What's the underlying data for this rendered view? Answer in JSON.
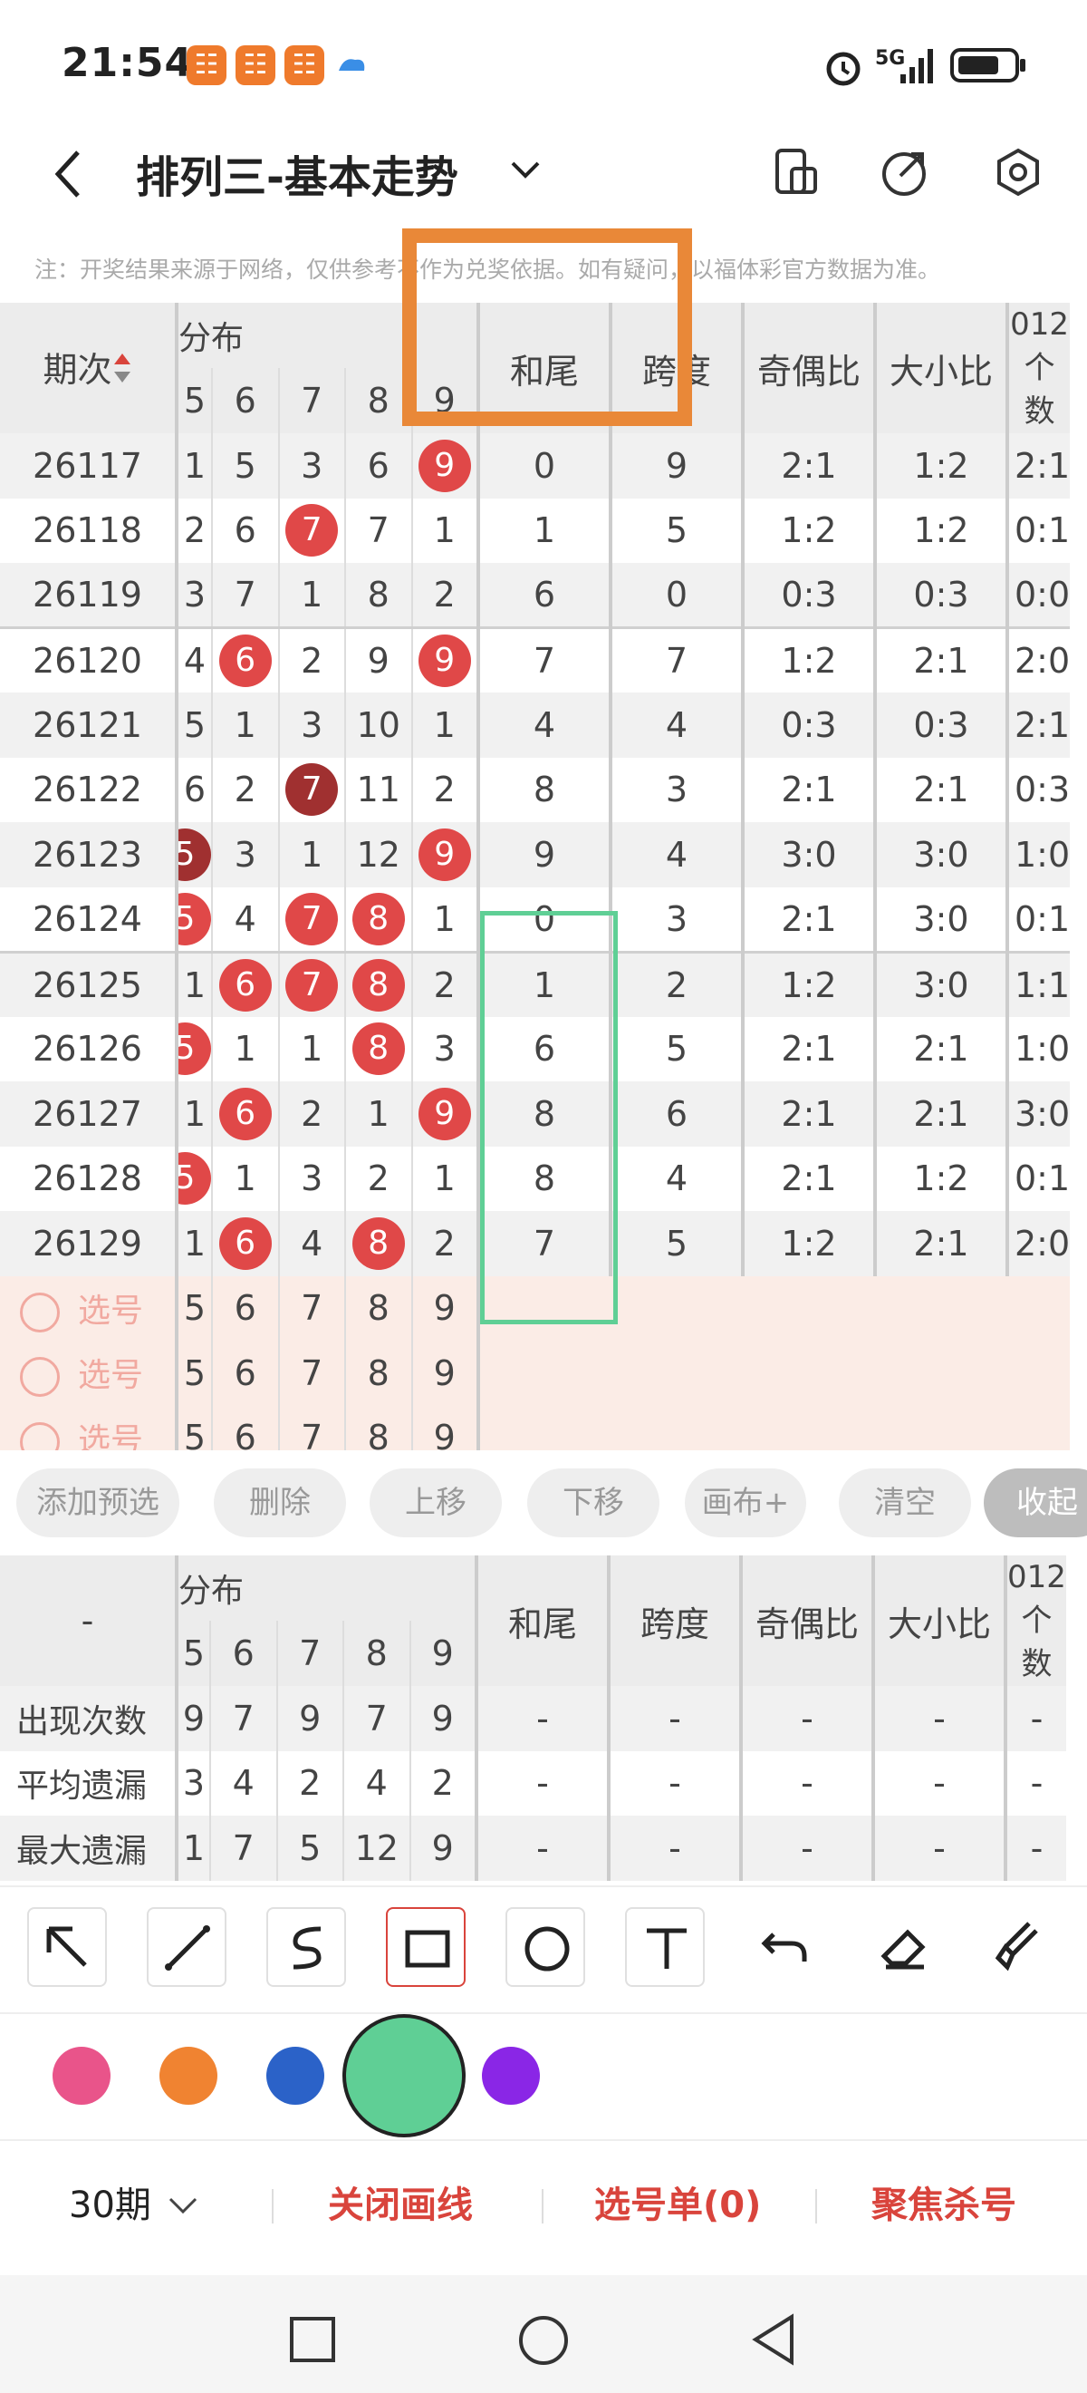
{
  "status": {
    "time": "21:54",
    "network": "5G"
  },
  "app_icons": [
    "app-icon-1",
    "app-icon-2",
    "app-icon-3",
    "cloud-icon"
  ],
  "header": {
    "title": "排列三-基本走势"
  },
  "notice": "注：开奖结果来源于网络，仅供参考不作为兑奖依据。如有疑问，以福体彩官方数据为准。",
  "table": {
    "head_group": "分布",
    "col_qi": "期次",
    "digits": [
      "5",
      "6",
      "7",
      "8",
      "9"
    ],
    "col_he": "和尾",
    "col_kd": "跨度",
    "col_jo": "奇偶比",
    "col_dx": "大小比",
    "col_012": "012个数",
    "rows": [
      {
        "qi": "26117",
        "d": [
          "1",
          "5",
          "3",
          "6",
          "9"
        ],
        "ball": [
          4
        ],
        "he": "0",
        "kd": "9",
        "jo": "2:1",
        "dx": "1:2",
        "l": "2:1"
      },
      {
        "qi": "26118",
        "d": [
          "2",
          "6",
          "7",
          "7",
          "1"
        ],
        "ball": [
          2
        ],
        "he": "1",
        "kd": "5",
        "jo": "1:2",
        "dx": "1:2",
        "l": "0:1"
      },
      {
        "qi": "26119",
        "d": [
          "3",
          "7",
          "1",
          "8",
          "2"
        ],
        "ball": [],
        "he": "6",
        "kd": "0",
        "jo": "0:3",
        "dx": "0:3",
        "l": "0:0"
      },
      {
        "qi": "26120",
        "d": [
          "4",
          "6",
          "2",
          "9",
          "9"
        ],
        "ball": [
          1,
          4
        ],
        "he": "7",
        "kd": "7",
        "jo": "1:2",
        "dx": "2:1",
        "l": "2:0"
      },
      {
        "qi": "26121",
        "d": [
          "5",
          "1",
          "3",
          "10",
          "1"
        ],
        "ball": [],
        "he": "4",
        "kd": "4",
        "jo": "0:3",
        "dx": "0:3",
        "l": "2:1"
      },
      {
        "qi": "26122",
        "d": [
          "6",
          "2",
          "7",
          "11",
          "2"
        ],
        "ball": [
          2
        ],
        "dark": [
          2
        ],
        "he": "8",
        "kd": "3",
        "jo": "2:1",
        "dx": "2:1",
        "l": "0:3"
      },
      {
        "qi": "26123",
        "d": [
          "5",
          "3",
          "1",
          "12",
          "9"
        ],
        "ball": [
          0,
          4
        ],
        "dark": [
          0
        ],
        "he": "9",
        "kd": "4",
        "jo": "3:0",
        "dx": "3:0",
        "l": "1:0"
      },
      {
        "qi": "26124",
        "d": [
          "5",
          "4",
          "7",
          "8",
          "1"
        ],
        "ball": [
          0,
          2,
          3
        ],
        "he": "0",
        "kd": "3",
        "jo": "2:1",
        "dx": "3:0",
        "l": "0:1"
      },
      {
        "qi": "26125",
        "d": [
          "1",
          "6",
          "7",
          "8",
          "2"
        ],
        "ball": [
          1,
          2,
          3
        ],
        "he": "1",
        "kd": "2",
        "jo": "1:2",
        "dx": "3:0",
        "l": "1:1"
      },
      {
        "qi": "26126",
        "d": [
          "5",
          "1",
          "1",
          "8",
          "3"
        ],
        "ball": [
          0,
          3
        ],
        "he": "6",
        "kd": "5",
        "jo": "2:1",
        "dx": "2:1",
        "l": "1:0"
      },
      {
        "qi": "26127",
        "d": [
          "1",
          "6",
          "2",
          "1",
          "9"
        ],
        "ball": [
          1,
          4
        ],
        "he": "8",
        "kd": "6",
        "jo": "2:1",
        "dx": "2:1",
        "l": "3:0"
      },
      {
        "qi": "26128",
        "d": [
          "5",
          "1",
          "3",
          "2",
          "1"
        ],
        "ball": [
          0
        ],
        "he": "8",
        "kd": "4",
        "jo": "2:1",
        "dx": "1:2",
        "l": "0:1"
      },
      {
        "qi": "26129",
        "d": [
          "1",
          "6",
          "4",
          "8",
          "2"
        ],
        "ball": [
          1,
          3
        ],
        "he": "7",
        "kd": "5",
        "jo": "1:2",
        "dx": "2:1",
        "l": "2:0"
      }
    ],
    "pick_label": "选号"
  },
  "actions": [
    "添加预选",
    "删除",
    "上移",
    "下移",
    "画布+",
    "清空",
    "收起"
  ],
  "stats": {
    "dash": "-",
    "rows": [
      {
        "label": "出现次数",
        "cls": "red",
        "v": [
          "9",
          "7",
          "9",
          "7",
          "9"
        ]
      },
      {
        "label": "平均遗漏",
        "cls": "red",
        "v": [
          "3",
          "4",
          "2",
          "4",
          "2"
        ]
      },
      {
        "label": "最大遗漏",
        "cls": "blue",
        "v": [
          "1",
          "7",
          "5",
          "12",
          "9"
        ]
      }
    ]
  },
  "tools": [
    "arrow-icon",
    "line-icon",
    "curve-icon",
    "rectangle-icon",
    "circle-icon",
    "text-icon",
    "undo-icon",
    "eraser-icon",
    "brush-icon"
  ],
  "colors": [
    "#e9548a",
    "#f08331",
    "#2b62c8",
    "#5fcf95",
    "#8a26e6"
  ],
  "bottom": {
    "period": "30期",
    "close_draw": "关闭画线",
    "pick_list": "选号单(0)",
    "focus_kill": "聚焦杀号"
  },
  "accent": "#d9443c"
}
